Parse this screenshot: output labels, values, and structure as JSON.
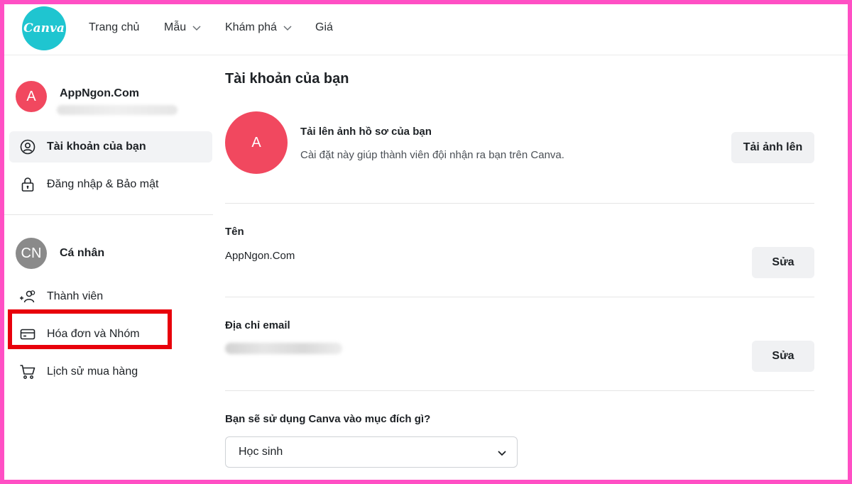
{
  "colors": {
    "frame_border": "#ff4fc4",
    "canva_teal": "#1fc5d0",
    "avatar_red": "#f1485f",
    "avatar_gray": "#8a8a8a",
    "highlight_red": "#e8000b"
  },
  "nav": {
    "logo_text": "Canva",
    "items": [
      {
        "label": "Trang chủ",
        "has_dropdown": false
      },
      {
        "label": "Mẫu",
        "has_dropdown": true
      },
      {
        "label": "Khám phá",
        "has_dropdown": true
      },
      {
        "label": "Giá",
        "has_dropdown": false
      }
    ]
  },
  "sidebar": {
    "user": {
      "initial": "A",
      "name": "AppNgon.Com"
    },
    "account_items": [
      {
        "label": "Tài khoản của bạn",
        "icon": "user-circle-icon",
        "active": true
      },
      {
        "label": "Đăng nhập & Bảo mật",
        "icon": "lock-icon",
        "active": false
      }
    ],
    "team": {
      "initials": "CN",
      "name": "Cá nhân"
    },
    "team_items": [
      {
        "label": "Thành viên",
        "icon": "add-people-icon"
      },
      {
        "label": "Hóa đơn và Nhóm",
        "icon": "credit-card-icon",
        "highlighted": true
      },
      {
        "label": "Lịch sử mua hàng",
        "icon": "shopping-cart-icon"
      }
    ]
  },
  "main": {
    "title": "Tài khoản của bạn",
    "profile": {
      "initial": "A",
      "heading": "Tải lên ảnh hồ sơ của bạn",
      "description": "Cài đặt này giúp thành viên đội nhận ra bạn trên Canva.",
      "button": "Tải ảnh lên"
    },
    "name_section": {
      "label": "Tên",
      "value": "AppNgon.Com",
      "button": "Sửa"
    },
    "email_section": {
      "label": "Địa chỉ email",
      "button": "Sửa"
    },
    "purpose_section": {
      "question": "Bạn sẽ sử dụng Canva vào mục đích gì?",
      "selected": "Học sinh"
    }
  }
}
